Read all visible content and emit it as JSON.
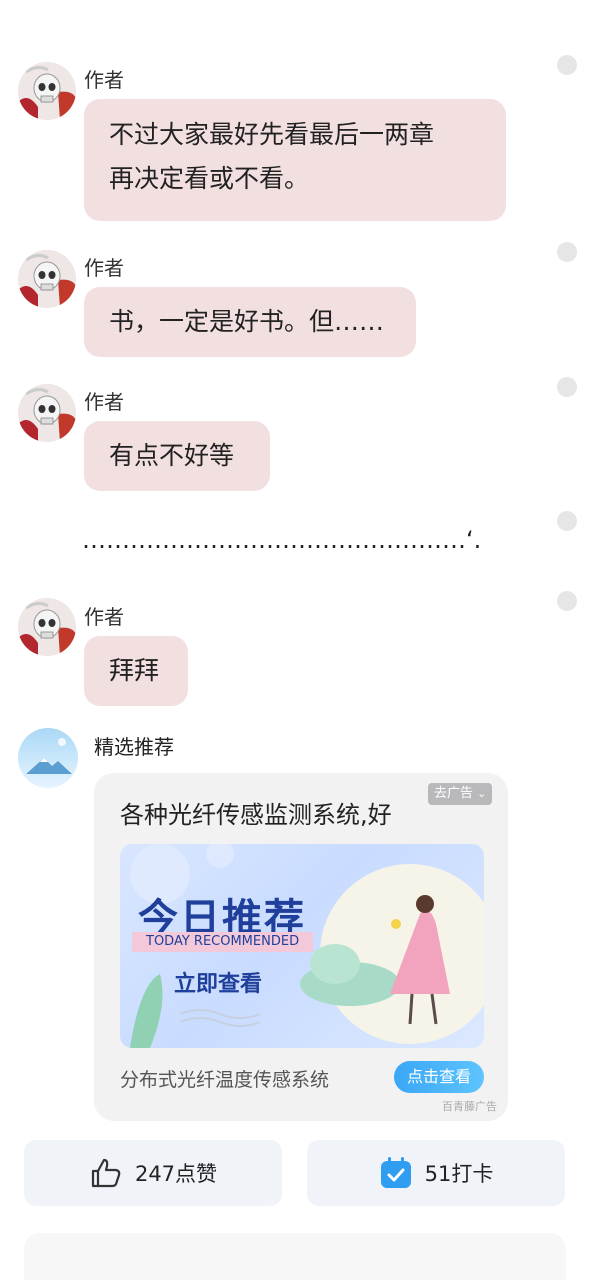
{
  "messages": [
    {
      "author": "作者",
      "lines": [
        "不过大家最好先看最后一两章",
        "再决定看或不看。"
      ]
    },
    {
      "author": "作者",
      "lines": [
        "书，一定是好书。但……"
      ]
    },
    {
      "author": "作者",
      "lines": [
        "有点不好等"
      ]
    },
    {
      "author": "",
      "lines": [
        "…………………………………………‘."
      ]
    },
    {
      "author": "作者",
      "lines": [
        "拜拜"
      ]
    }
  ],
  "recommend": {
    "title": "精选推荐",
    "ad": {
      "headline": "各种光纤传感监测系统,好",
      "tag": "去广告",
      "banner_title": "今日推荐",
      "banner_subtitle": "TODAY RECOMMENDED",
      "banner_button": "立即查看",
      "description": "分布式光纤温度传感系统",
      "cta": "点击查看",
      "source": "百青藤广告"
    }
  },
  "actions": {
    "like_count": "247",
    "like_label": "点赞",
    "checkin_count": "51",
    "checkin_label": "打卡"
  },
  "colors": {
    "bubble": "#f2e0e1",
    "accent": "#3aa7f5",
    "banner_text": "#1f3f9a"
  }
}
